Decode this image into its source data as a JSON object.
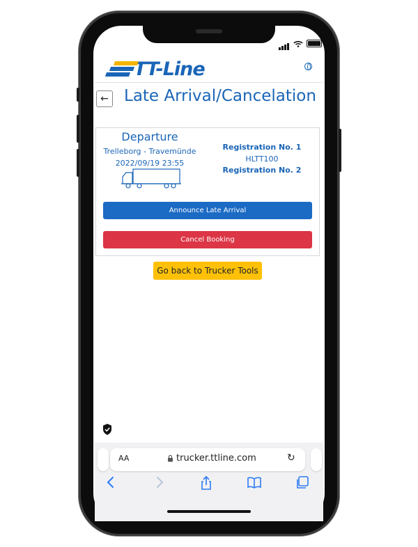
{
  "header": {
    "logo_text": "TT-Line",
    "brand_color": "#1a65b7",
    "globe_icon": "globe-icon"
  },
  "page": {
    "title": "Late Arrival/Cancelation",
    "back_icon": "←"
  },
  "booking": {
    "departure_label": "Departure",
    "route": "Trelleborg - Travemünde",
    "datetime": "2022/09/19 23:55",
    "registration_1_label": "Registration No. 1",
    "registration_1_value": "HLTT100",
    "registration_2_label": "Registration No. 2"
  },
  "actions": {
    "announce_label": "Announce Late Arrival",
    "cancel_label": "Cancel Booking",
    "back_tools_label": "Go back to Trucker Tools",
    "colors": {
      "primary": "#1b6bc5",
      "danger": "#dc3545",
      "warning": "#ffc107"
    }
  },
  "browser": {
    "aa_label": "AA",
    "url": "trucker.ttline.com",
    "reload_icon": "↻",
    "toolbar": [
      "back-icon",
      "forward-icon",
      "share-icon",
      "bookmarks-icon",
      "tabs-icon"
    ]
  }
}
